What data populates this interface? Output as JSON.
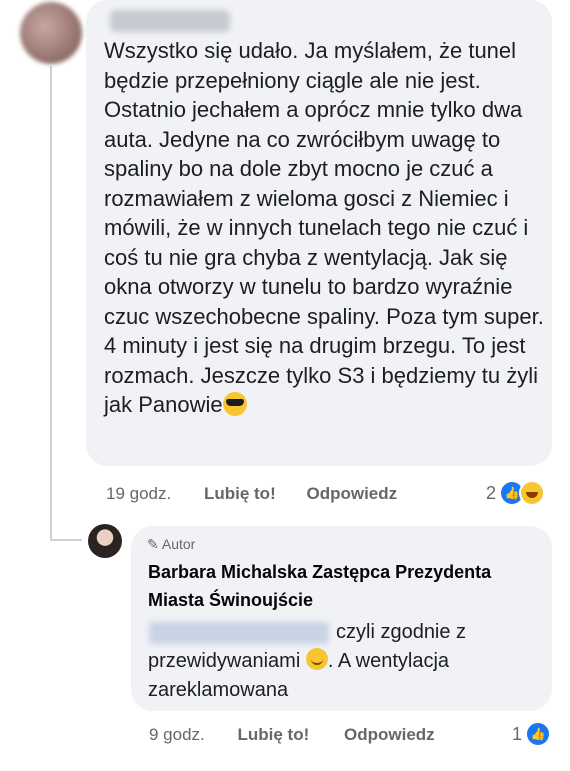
{
  "comment": {
    "text": "Wszystko się udało. Ja myślałem, że tunel będzie przepełniony ciągle ale nie jest. Ostatnio jechałem a oprócz mnie tylko dwa auta. Jedyne na co zwróciłbym uwagę to spaliny bo na dole zbyt mocno je czuć a rozmawiałem z wieloma gosci z Niemiec i mówili, że w innych tunelach tego nie czuć i coś tu nie gra chyba z wentylacją. Jak się okna otworzy w tunelu to bardzo wyraźnie czuc wszechobecne spaliny. Poza tym super. 4 minuty i jest się na drugim brzegu. To jest rozmach. Jeszcze tylko S3 i będziemy tu żyli jak Panowie",
    "emoji": "sunglasses-emoji",
    "time": "19 godz.",
    "like_label": "Lubię to!",
    "reply_label": "Odpowiedz",
    "reaction_count": "2",
    "reactions": [
      "like-reaction",
      "haha-reaction"
    ]
  },
  "reply": {
    "badge": "Autor",
    "author": "Barbara Michalska Zastępca Prezydenta Miasta Świnoujście",
    "text_before_emoji": "czyli  zgodnie z przewidywaniami",
    "text_after_emoji": ". A wentylacja zareklamowana",
    "emoji": "smile-emoji",
    "time": "9 godz.",
    "like_label": "Lubię to!",
    "reply_label": "Odpowiedz",
    "reaction_count": "1",
    "reactions": [
      "like-reaction"
    ]
  },
  "colors": {
    "bubble": "#f0f2f5",
    "secondary_text": "#65676b",
    "like_blue": "#1877f2"
  }
}
